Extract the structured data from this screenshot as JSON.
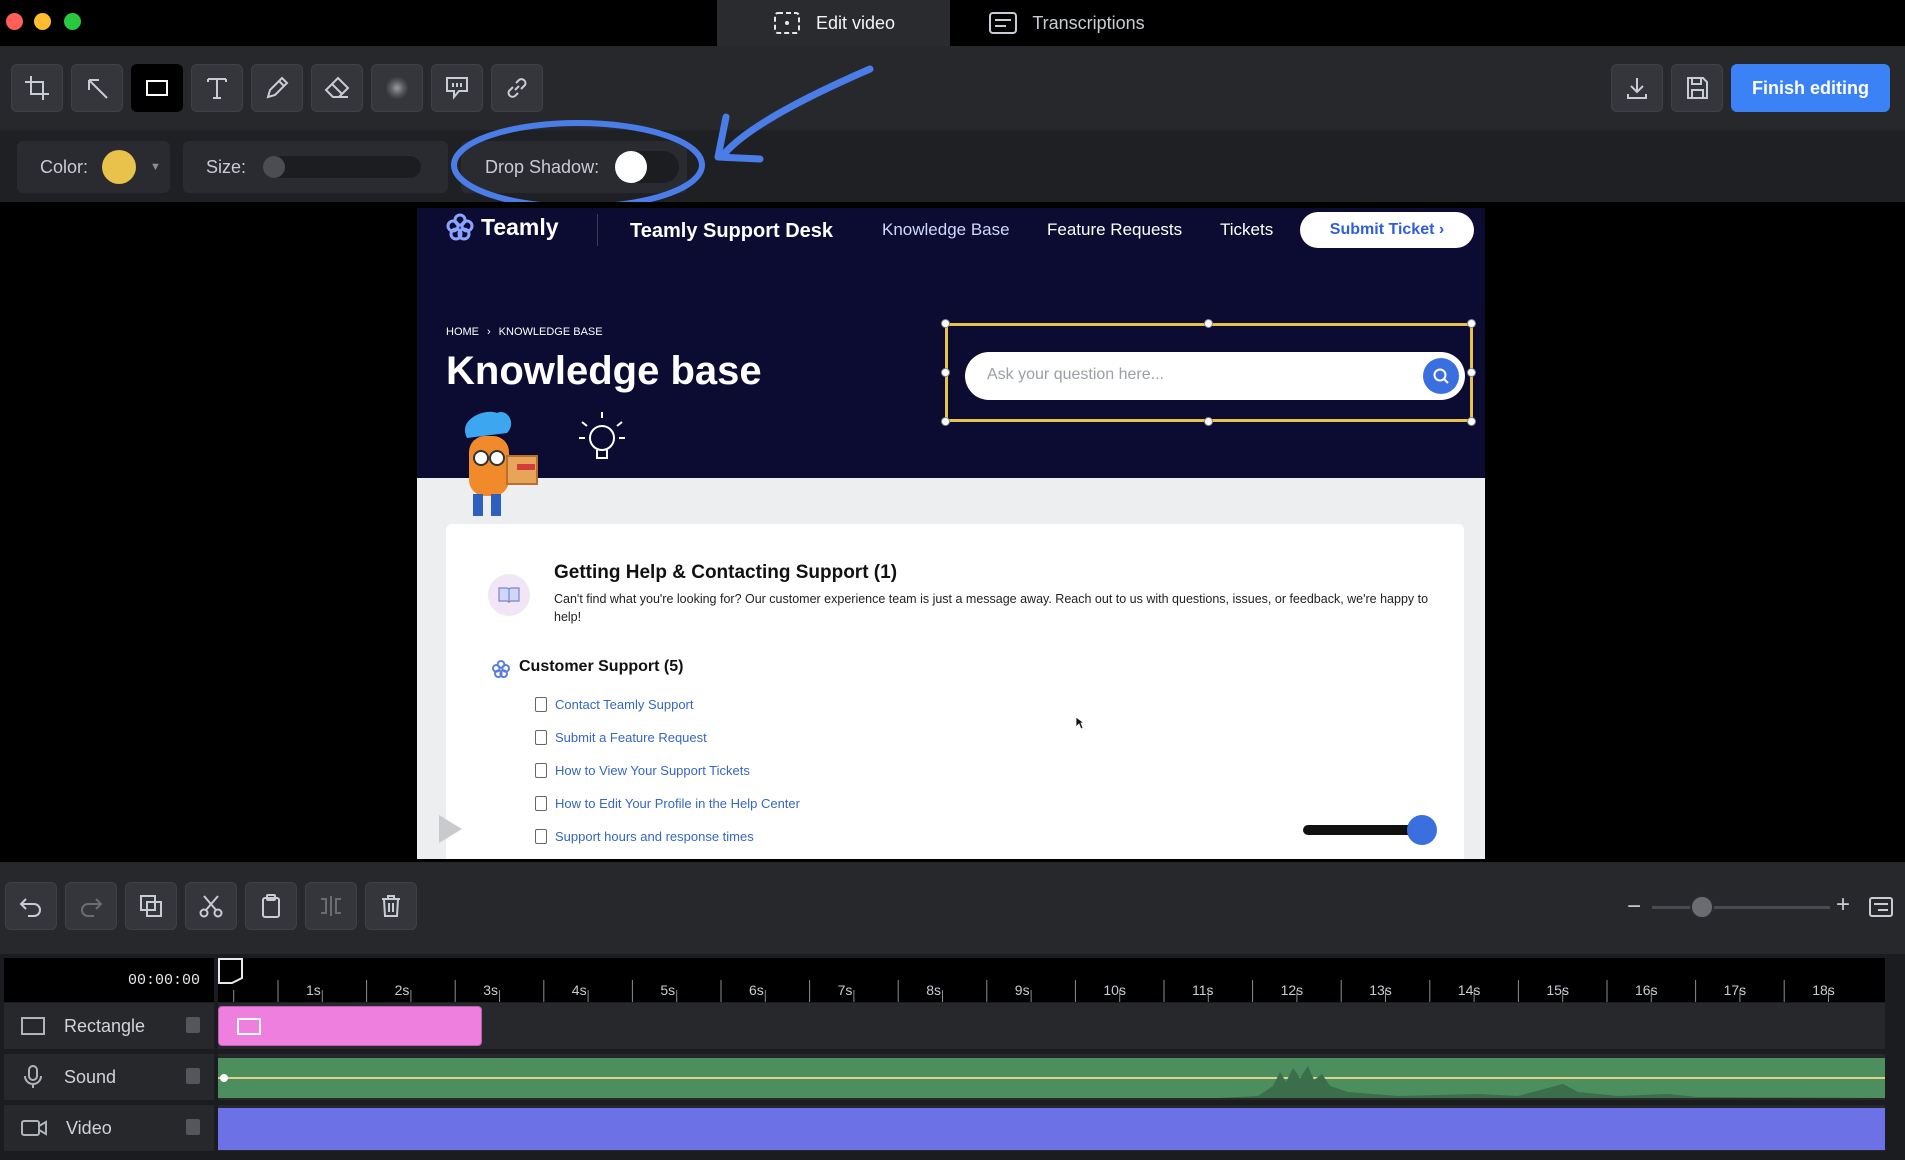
{
  "window": {
    "tabs": [
      {
        "label": "Edit video",
        "icon": "edit-video-icon",
        "active": true
      },
      {
        "label": "Transcriptions",
        "icon": "transcriptions-icon",
        "active": false
      }
    ]
  },
  "toolbar": {
    "tools": [
      {
        "name": "crop-tool",
        "icon": "crop-icon"
      },
      {
        "name": "arrow-tool",
        "icon": "arrow-icon"
      },
      {
        "name": "rectangle-tool",
        "icon": "rectangle-icon",
        "selected": true
      },
      {
        "name": "text-tool",
        "icon": "text-icon"
      },
      {
        "name": "pen-tool",
        "icon": "pen-icon"
      },
      {
        "name": "eraser-tool",
        "icon": "eraser-icon"
      },
      {
        "name": "blur-tool",
        "icon": "blur-icon"
      },
      {
        "name": "callout-tool",
        "icon": "callout-icon"
      },
      {
        "name": "link-tool",
        "icon": "link-icon"
      }
    ],
    "finish_label": "Finish editing"
  },
  "properties": {
    "color_label": "Color:",
    "color_value": "#e8c24a",
    "size_label": "Size:",
    "size_value": 0,
    "drop_shadow_label": "Drop Shadow:",
    "drop_shadow_on": false
  },
  "video_frame": {
    "brand": "Teamly",
    "site_title": "Teamly Support Desk",
    "nav": [
      "Knowledge Base",
      "Feature Requests",
      "Tickets"
    ],
    "submit_ticket": "Submit Ticket ›",
    "breadcrumb": [
      "HOME",
      "KNOWLEDGE BASE"
    ],
    "page_title": "Knowledge base",
    "search_placeholder": "Ask your question here...",
    "section_title": "Getting Help & Contacting Support (1)",
    "section_desc": "Can't find what you're looking for? Our customer experience team is just a message away. Reach out to us with questions, issues, or feedback, we're happy to help!",
    "category_title": "Customer Support (5)",
    "articles": [
      "Contact Teamly Support",
      "Submit a Feature Request",
      "How to View Your Support Tickets",
      "How to Edit Your Profile in the Help Center",
      "Support hours and response times"
    ],
    "playback_progress": 0
  },
  "edit_bar": {
    "tools": [
      {
        "name": "undo-button",
        "icon": "undo-icon"
      },
      {
        "name": "redo-button",
        "icon": "redo-icon",
        "disabled": true
      },
      {
        "name": "duplicate-button",
        "icon": "duplicate-icon"
      },
      {
        "name": "cut-button",
        "icon": "scissors-icon"
      },
      {
        "name": "paste-button",
        "icon": "clipboard-icon"
      },
      {
        "name": "split-button",
        "icon": "split-icon",
        "disabled": true
      },
      {
        "name": "delete-button",
        "icon": "trash-icon"
      }
    ],
    "zoom_level": 0.25
  },
  "timeline": {
    "current_time": "00:00:00",
    "ticks": [
      "1s",
      "2s",
      "3s",
      "4s",
      "5s",
      "6s",
      "7s",
      "8s",
      "9s",
      "10s",
      "11s",
      "12s",
      "13s",
      "14s",
      "15s",
      "16s",
      "17s",
      "18s"
    ],
    "tracks": [
      {
        "label": "Rectangle",
        "icon": "rectangle-icon"
      },
      {
        "label": "Sound",
        "icon": "microphone-icon"
      },
      {
        "label": "Video",
        "icon": "video-camera-icon"
      }
    ],
    "colors": {
      "rectangle_clip": "#ef7fde",
      "sound_clip": "#4c8e5d",
      "video_clip": "#6c72e6",
      "accent": "#3b82f6"
    }
  }
}
